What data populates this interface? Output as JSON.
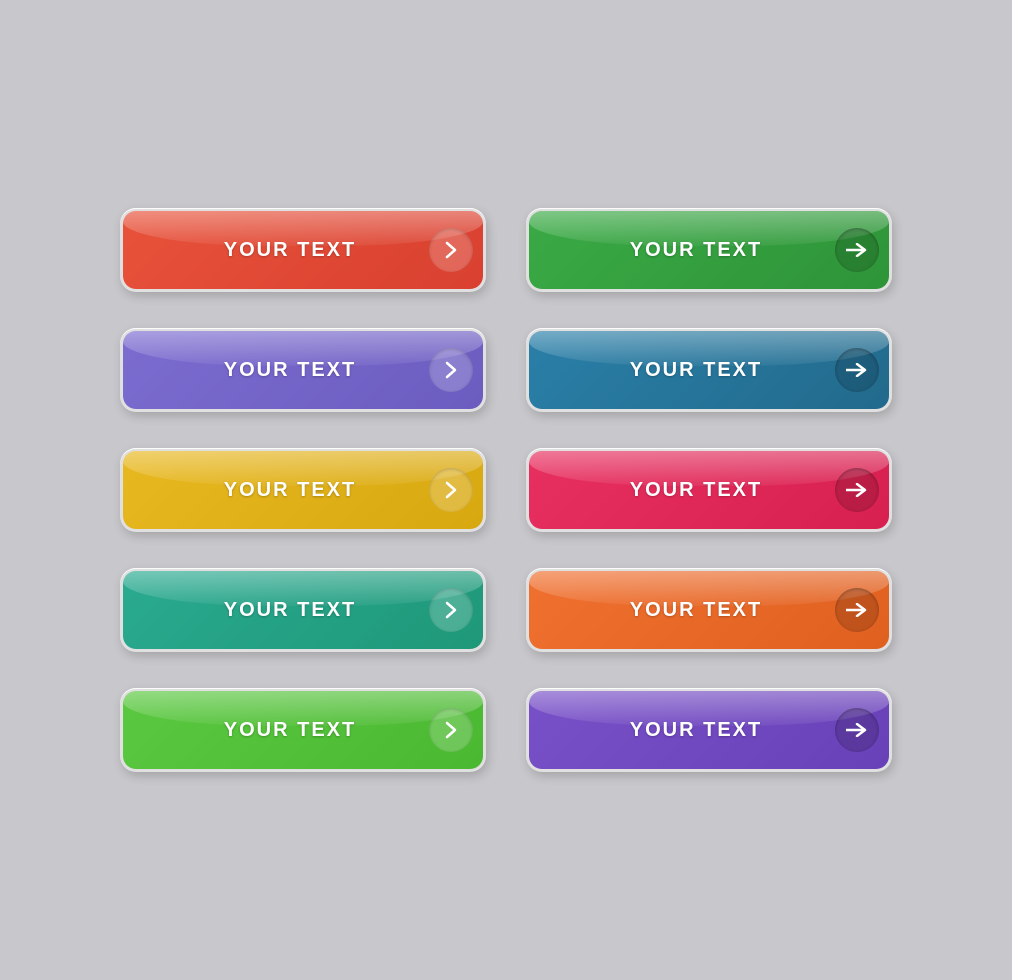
{
  "buttons": [
    {
      "id": "btn-red",
      "label": "YOUR TEXT",
      "color": "color-red",
      "style": "style-a",
      "icon": "chevron"
    },
    {
      "id": "btn-green",
      "label": "YOUR TEXT",
      "color": "color-green",
      "style": "style-b",
      "icon": "arrow"
    },
    {
      "id": "btn-purple",
      "label": "YOUR TEXT",
      "color": "color-purple",
      "style": "style-a",
      "icon": "chevron"
    },
    {
      "id": "btn-teal",
      "label": "YOUR TEXT",
      "color": "color-teal",
      "style": "style-b",
      "icon": "arrow"
    },
    {
      "id": "btn-yellow",
      "label": "YOUR TEXT",
      "color": "color-yellow",
      "style": "style-a",
      "icon": "chevron"
    },
    {
      "id": "btn-pink",
      "label": "YOUR TEXT",
      "color": "color-pink",
      "style": "style-b",
      "icon": "arrow"
    },
    {
      "id": "btn-cyan",
      "label": "YOUR TEXT",
      "color": "color-cyan",
      "style": "style-a",
      "icon": "chevron"
    },
    {
      "id": "btn-orange",
      "label": "YOUR TEXT",
      "color": "color-orange",
      "style": "style-b",
      "icon": "arrow"
    },
    {
      "id": "btn-lime",
      "label": "YOUR TEXT",
      "color": "color-lime",
      "style": "style-a",
      "icon": "chevron"
    },
    {
      "id": "btn-indigo",
      "label": "YOUR TEXT",
      "color": "color-indigo",
      "style": "style-b",
      "icon": "arrow"
    }
  ]
}
